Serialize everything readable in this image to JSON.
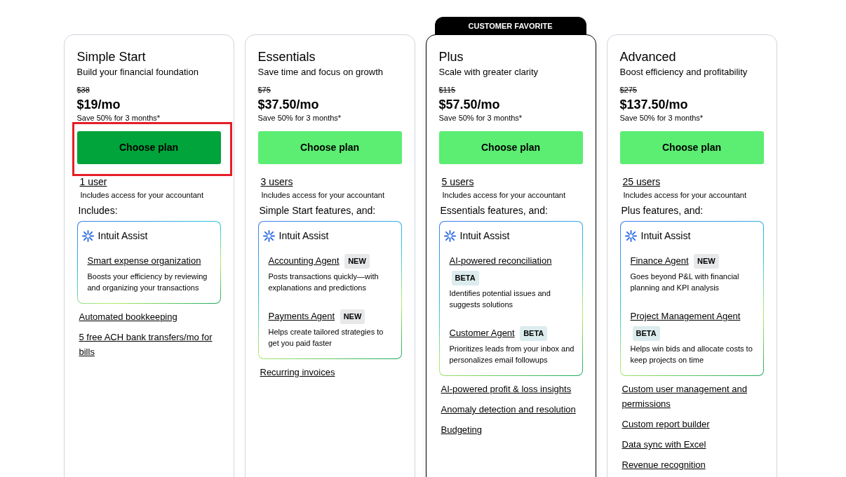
{
  "plans": [
    {
      "name": "Simple Start",
      "tagline": "Build your financial foundation",
      "old_price": "$38",
      "price": "$19/mo",
      "promo": "Save 50% for 3 months*",
      "button": {
        "label": "Choose plan",
        "selected": true,
        "highlighted": true
      },
      "featured": false,
      "users": "1 user",
      "users_note": "Includes access for your accountant",
      "includes_label": "Includes:",
      "assist": {
        "title": "Intuit Assist",
        "items": [
          {
            "title": "Smart expense organization",
            "description": "Boosts your efficiency by reviewing and organizing your transactions"
          }
        ]
      },
      "features": [
        "Automated bookkeeping",
        "5 free ACH bank transfers/mo for bills"
      ]
    },
    {
      "name": "Essentials",
      "tagline": "Save time and focus on growth",
      "old_price": "$75",
      "price": "$37.50/mo",
      "promo": "Save 50% for 3 months*",
      "button": {
        "label": "Choose plan",
        "selected": false
      },
      "featured": false,
      "users": "3 users",
      "users_note": "Includes access for your accountant",
      "includes_label": "Simple Start features, and:",
      "assist": {
        "title": "Intuit Assist",
        "items": [
          {
            "title": "Accounting Agent",
            "badge": {
              "label": "NEW",
              "kind": "new"
            },
            "description": "Posts transactions quickly—with explanations and predictions"
          },
          {
            "title": "Payments Agent",
            "badge": {
              "label": "NEW",
              "kind": "new"
            },
            "description": "Helps create tailored strategies to get you paid faster"
          }
        ]
      },
      "features": [
        "Recurring invoices"
      ]
    },
    {
      "name": "Plus",
      "tagline": "Scale with greater clarity",
      "old_price": "$115",
      "price": "$57.50/mo",
      "promo": "Save 50% for 3 months*",
      "button": {
        "label": "Choose plan",
        "selected": false
      },
      "featured": true,
      "featured_label": "CUSTOMER FAVORITE",
      "users": "5 users",
      "users_note": "Includes access for your accountant",
      "includes_label": "Essentials features, and:",
      "assist": {
        "title": "Intuit Assist",
        "items": [
          {
            "title": "AI-powered reconciliation",
            "badge": {
              "label": "BETA",
              "kind": "beta"
            },
            "description": "Identifies potential issues and suggests solutions"
          },
          {
            "title": "Customer Agent",
            "badge": {
              "label": "BETA",
              "kind": "beta"
            },
            "description": "Prioritizes leads from your inbox and personalizes email followups"
          }
        ]
      },
      "features": [
        "AI-powered profit & loss insights",
        "Anomaly detection and resolution",
        "Budgeting"
      ]
    },
    {
      "name": "Advanced",
      "tagline": "Boost efficiency and profitability",
      "old_price": "$275",
      "price": "$137.50/mo",
      "promo": "Save 50% for 3 months*",
      "button": {
        "label": "Choose plan",
        "selected": false
      },
      "featured": false,
      "users": "25 users",
      "users_note": "Includes access for your accountant",
      "includes_label": "Plus features, and:",
      "assist": {
        "title": "Intuit Assist",
        "items": [
          {
            "title": "Finance Agent",
            "badge": {
              "label": "NEW",
              "kind": "new"
            },
            "description": "Goes beyond P&L with financial planning and KPI analysis"
          },
          {
            "title": "Project Management Agent",
            "badge": {
              "label": "BETA",
              "kind": "beta"
            },
            "description": "Helps win bids and allocate costs to keep projects on time"
          }
        ]
      },
      "features": [
        "Custom user management and permissions",
        "Custom report builder",
        "Data sync with Excel",
        "Revenue recognition"
      ]
    }
  ]
}
